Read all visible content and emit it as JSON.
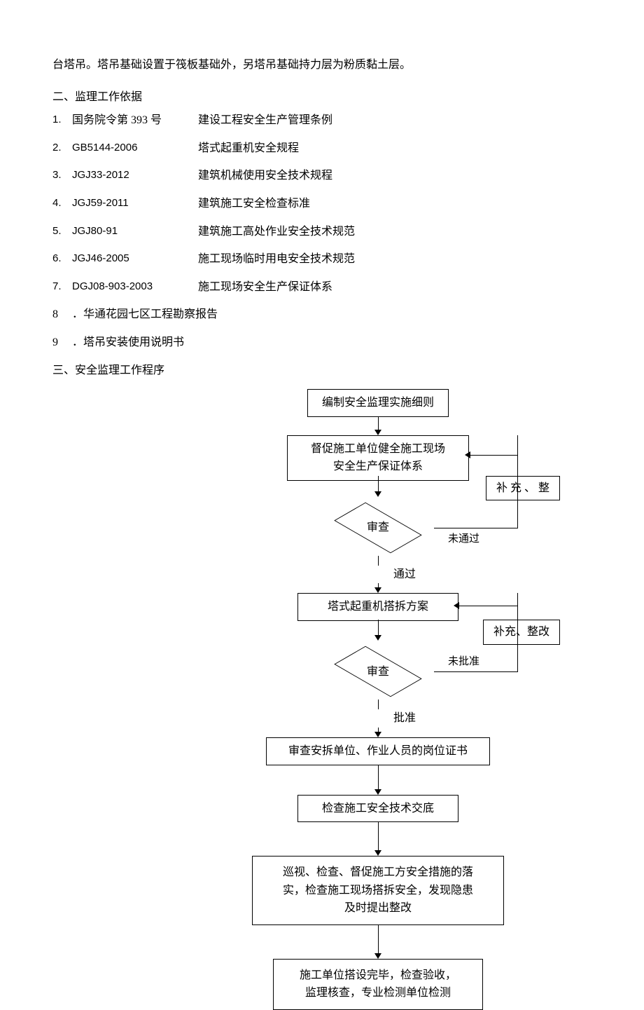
{
  "intro": "台塔吊。塔吊基础设置于筏板基础外，另塔吊基础持力层为粉质黏土层。",
  "section2_title": "二、监理工作依据",
  "refs": [
    {
      "num": "1.",
      "code": "国务院令第 393 号",
      "name": "建设工程安全生产管理条例"
    },
    {
      "num": "2.",
      "code": "GB5144-2006",
      "name": "塔式起重机安全规程"
    },
    {
      "num": "3.",
      "code": "JGJ33-2012",
      "name": "建筑机械使用安全技术规程"
    },
    {
      "num": "4.",
      "code": "JGJ59-2011",
      "name": "建筑施工安全检查标准"
    },
    {
      "num": "5.",
      "code": "JGJ80-91",
      "name": "建筑施工高处作业安全技术规范"
    },
    {
      "num": "6.",
      "code": "JGJ46-2005",
      "name": "施工现场临时用电安全技术规范"
    },
    {
      "num": "7.",
      "code": "DGJ08-903-2003",
      "name": "施工现场安全生产保证体系"
    }
  ],
  "item8_num": "8",
  "item8_text": "．华通花园七区工程勘察报告",
  "item9_num": "9",
  "item9_text": "．塔吊安装使用说明书",
  "section3_title": "三、安全监理工作程序",
  "flow": {
    "box1": "编制安全监理实施细则",
    "box2_line1": "督促施工单位健全施工现场",
    "box2_line2": "安全生产保证体系",
    "side1": "补 充 、 整",
    "diamond1": "审查",
    "fail1": "未通过",
    "pass1": "通过",
    "box3": "塔式起重机搭拆方案",
    "side2": "补充、整改",
    "diamond2": "审查",
    "fail2": "未批准",
    "pass2": "批准",
    "box4": "审查安拆单位、作业人员的岗位证书",
    "box5": "检查施工安全技术交底",
    "box6_line1": "巡视、检查、督促施工方安全措施的落",
    "box6_line2": "实，检查施工现场搭拆安全，发现隐患",
    "box6_line3": "及时提出整改",
    "box7_line1": "施工单位搭设完毕，检查验收，",
    "box7_line2": "监理核查，专业检测单位检测"
  }
}
